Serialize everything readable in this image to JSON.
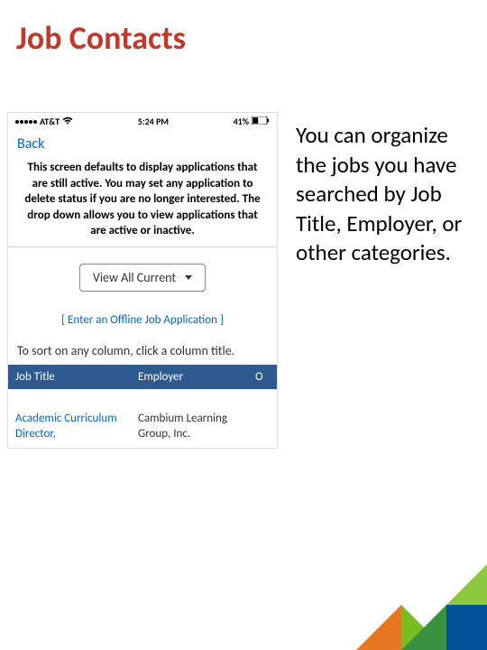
{
  "slide": {
    "title": "Job Contacts"
  },
  "phone": {
    "status": {
      "carrier": "AT&T",
      "time": "5:24 PM",
      "battery": "41%"
    },
    "back_label": "Back",
    "info_text": "This screen defaults to display applications that are still active. You may set any application to delete status if you are no longer interested. The drop down allows you to view applications that are active or inactive.",
    "dropdown_label": "View All Current",
    "offline_link": "[ Enter an Offline Job Application ]",
    "sort_hint": "To sort on any column, click a column title.",
    "table": {
      "headers": {
        "col1": "Job Title",
        "col2": "Employer",
        "col3": "O"
      },
      "rows": [
        {
          "title": "Academic Curriculum Director,",
          "employer": "Cambium Learning Group, Inc."
        }
      ]
    }
  },
  "description": "You can organize the jobs you have searched by Job Title, Employer, or other categories."
}
